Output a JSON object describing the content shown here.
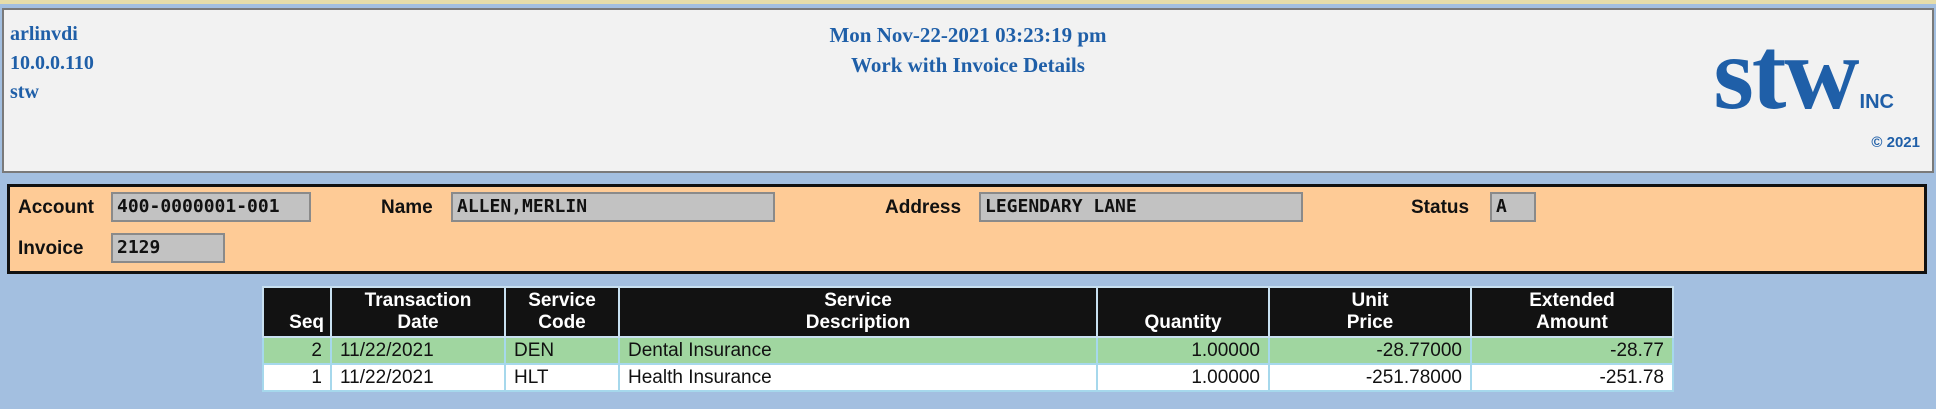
{
  "header": {
    "host": "arlinvdi",
    "ip": "10.0.0.110",
    "user": "stw",
    "datetime": "Mon Nov-22-2021 03:23:19 pm",
    "title": "Work with Invoice Details",
    "logo": "stw",
    "logo_suffix": "INC",
    "copyright": "© 2021"
  },
  "info": {
    "account_label": "Account",
    "account_value": "400-0000001-001",
    "name_label": "Name",
    "name_value": "ALLEN,MERLIN",
    "address_label": "Address",
    "address_value": "LEGENDARY LANE",
    "status_label": "Status",
    "status_value": "A",
    "invoice_label": "Invoice",
    "invoice_value": "2129"
  },
  "table": {
    "headers": {
      "seq": "Seq",
      "trans_date_1": "Transaction",
      "trans_date_2": "Date",
      "svc_code_1": "Service",
      "svc_code_2": "Code",
      "svc_desc_1": "Service",
      "svc_desc_2": "Description",
      "quantity": "Quantity",
      "unit_price_1": "Unit",
      "unit_price_2": "Price",
      "ext_amount_1": "Extended",
      "ext_amount_2": "Amount"
    },
    "rows": [
      {
        "seq": "2",
        "date": "11/22/2021",
        "code": "DEN",
        "desc": "Dental Insurance",
        "qty": "1.00000",
        "price": "-28.77000",
        "amount": "-28.77"
      },
      {
        "seq": "1",
        "date": "11/22/2021",
        "code": "HLT",
        "desc": "Health Insurance",
        "qty": "1.00000",
        "price": "-251.78000",
        "amount": "-251.78"
      }
    ]
  },
  "colors": {
    "accent_blue": "#1f5fa8",
    "info_panel": "#fecb96",
    "selected_row": "#a0d6a0",
    "background": "#a3bfe0"
  }
}
